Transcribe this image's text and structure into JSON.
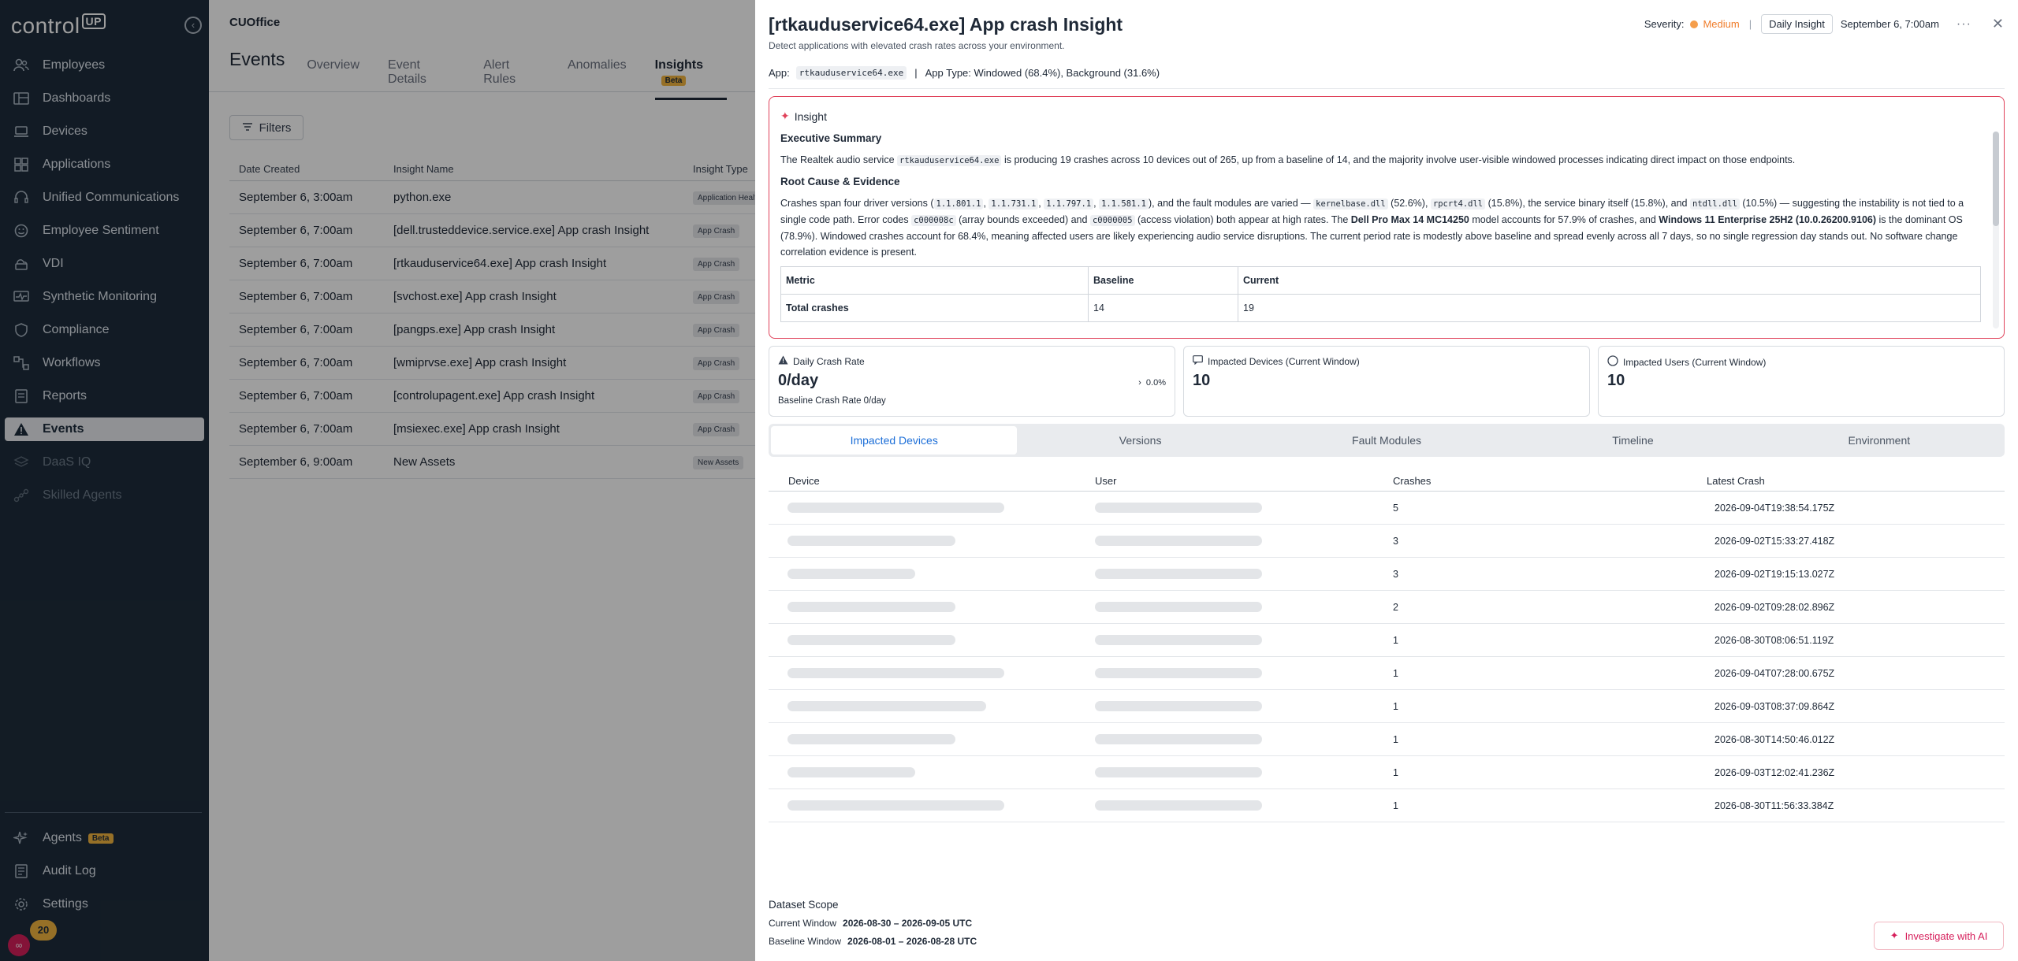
{
  "sidebar": {
    "logo": "control",
    "logo_suffix": "UP",
    "collapse_icon": "chevron-left-icon",
    "items": [
      {
        "label": "Employees",
        "icon": "users-icon"
      },
      {
        "label": "Dashboards",
        "icon": "dashboard-icon"
      },
      {
        "label": "Devices",
        "icon": "laptop-icon"
      },
      {
        "label": "Applications",
        "icon": "apps-icon"
      },
      {
        "label": "Unified Communications",
        "icon": "headset-icon"
      },
      {
        "label": "Employee Sentiment",
        "icon": "smile-icon"
      },
      {
        "label": "VDI",
        "icon": "cloud-desktop-icon"
      },
      {
        "label": "Synthetic Monitoring",
        "icon": "monitor-pulse-icon"
      },
      {
        "label": "Compliance",
        "icon": "shield-icon"
      },
      {
        "label": "Workflows",
        "icon": "workflow-icon"
      },
      {
        "label": "Reports",
        "icon": "report-icon"
      },
      {
        "label": "Events",
        "icon": "warning-icon"
      },
      {
        "label": "DaaS IQ",
        "icon": "layers-icon"
      },
      {
        "label": "Skilled Agents",
        "icon": "nodes-icon"
      }
    ],
    "bottom_items": [
      {
        "label": "Agents",
        "badge": "Beta",
        "icon": "sparkle-icon"
      },
      {
        "label": "Audit Log",
        "icon": "log-icon"
      },
      {
        "label": "Settings",
        "icon": "gear-icon"
      }
    ],
    "notification_count": "20"
  },
  "main": {
    "org": "CUOffice",
    "page_title": "Events",
    "tabs": [
      "Overview",
      "Event Details",
      "Alert Rules",
      "Anomalies",
      "Insights"
    ],
    "insights_badge": "Beta",
    "filters_label": "Filters",
    "columns": [
      "Date Created",
      "Insight Name",
      "Insight Type"
    ],
    "rows": [
      {
        "date": "September 6, 3:00am",
        "name": "python.exe",
        "type": "Application Health"
      },
      {
        "date": "September 6, 7:00am",
        "name": "[dell.trusteddevice.service.exe] App crash Insight",
        "type": "App Crash"
      },
      {
        "date": "September 6, 7:00am",
        "name": "[rtkauduservice64.exe] App crash Insight",
        "type": "App Crash"
      },
      {
        "date": "September 6, 7:00am",
        "name": "[svchost.exe] App crash Insight",
        "type": "App Crash"
      },
      {
        "date": "September 6, 7:00am",
        "name": "[pangps.exe] App crash Insight",
        "type": "App Crash"
      },
      {
        "date": "September 6, 7:00am",
        "name": "[wmiprvse.exe] App crash Insight",
        "type": "App Crash"
      },
      {
        "date": "September 6, 7:00am",
        "name": "[controlupagent.exe] App crash Insight",
        "type": "App Crash"
      },
      {
        "date": "September 6, 7:00am",
        "name": "[msiexec.exe] App crash Insight",
        "type": "App Crash"
      },
      {
        "date": "September 6, 9:00am",
        "name": "New Assets",
        "type": "New Assets"
      }
    ]
  },
  "drawer": {
    "title": "[rtkauduservice64.exe] App crash Insight",
    "subtitle": "Detect applications with elevated crash rates across your environment.",
    "severity_label": "Severity:",
    "severity_value": "Medium",
    "severity_color": "#f07d2b",
    "cadence_button": "Daily Insight",
    "date": "September 6, 7:00am",
    "app_label": "App:",
    "app_name": "rtkauduservice64.exe",
    "app_type": "App Type: Windowed (68.4%), Background (31.6%)",
    "insight": {
      "header": "Insight",
      "exec_title": "Executive Summary",
      "exec_p1": "The Realtek audio service",
      "exec_code": "rtkauduservice64.exe",
      "exec_p2": "is producing 19 crashes across 10 devices out of 265, up from a baseline of 14, and the majority involve user-visible windowed processes indicating direct impact on those endpoints.",
      "root_title": "Root Cause & Evidence",
      "rc_1": "Crashes span four driver versions (",
      "v1": "1.1.801.1",
      "v2": "1.1.731.1",
      "v3": "1.1.797.1",
      "v4": "1.1.581.1",
      "rc_2": "), and the fault modules are varied —",
      "m1": "kernelbase.dll",
      "m1p": "(52.6%),",
      "m2": "rpcrt4.dll",
      "m2p": "(15.8%), the service binary itself (15.8%), and",
      "m3": "ntdll.dll",
      "rc_3": "(10.5%) — suggesting the instability is not tied to a single code path. Error codes",
      "e1": "c000008c",
      "e1p": "(array bounds exceeded) and",
      "e2": "c0000005",
      "rc_4": "(access violation) both appear at high rates. The",
      "model": "Dell Pro Max 14 MC14250",
      "rc_5": "model accounts for 57.9% of crashes, and",
      "os": "Windows 11 Enterprise 25H2 (10.0.26200.9106)",
      "rc_6": "is the dominant OS (78.9%). Windowed crashes account for 68.4%, meaning affected users are likely experiencing audio service disruptions. The current period rate is modestly above baseline and spread evenly across all 7 days, so no single regression day stands out. No software change correlation evidence is present.",
      "metric_table": {
        "headers": [
          "Metric",
          "Baseline",
          "Current"
        ],
        "rows": [
          [
            "Total crashes",
            "14",
            "19"
          ]
        ]
      }
    },
    "cards": [
      {
        "label": "Daily Crash Rate",
        "icon": "warning-icon",
        "value": "0/day",
        "delta": "0.0%",
        "delta_icon": "chevron-right-icon",
        "foot": "Baseline Crash Rate 0/day"
      },
      {
        "label": "Impacted Devices (Current Window)",
        "icon": "chat-icon",
        "value": "10"
      },
      {
        "label": "Impacted Users (Current Window)",
        "icon": "circle-icon",
        "value": "10"
      }
    ],
    "tabs": [
      "Impacted Devices",
      "Versions",
      "Fault Modules",
      "Timeline",
      "Environment"
    ],
    "device_columns": [
      "Device",
      "User",
      "Crashes",
      "Latest Crash"
    ],
    "device_rows": [
      {
        "crashes": "5",
        "latest": "2026-09-04T19:38:54.175Z"
      },
      {
        "crashes": "3",
        "latest": "2026-09-02T15:33:27.418Z"
      },
      {
        "crashes": "3",
        "latest": "2026-09-02T19:15:13.027Z"
      },
      {
        "crashes": "2",
        "latest": "2026-09-02T09:28:02.896Z"
      },
      {
        "crashes": "1",
        "latest": "2026-08-30T08:06:51.119Z"
      },
      {
        "crashes": "1",
        "latest": "2026-09-04T07:28:00.675Z"
      },
      {
        "crashes": "1",
        "latest": "2026-09-03T08:37:09.864Z"
      },
      {
        "crashes": "1",
        "latest": "2026-08-30T14:50:46.012Z"
      },
      {
        "crashes": "1",
        "latest": "2026-09-03T12:02:41.236Z"
      },
      {
        "crashes": "1",
        "latest": "2026-08-30T11:56:33.384Z"
      }
    ],
    "scope": {
      "title": "Dataset Scope",
      "current_label": "Current Window",
      "current_value": "2026-08-30 – 2026-09-05 UTC",
      "baseline_label": "Baseline Window",
      "baseline_value": "2026-08-01 – 2026-08-28 UTC"
    },
    "ai_button": "Investigate with AI",
    "accent_ai": "#d61f5b",
    "accent_tab": "#1d6fd8"
  }
}
